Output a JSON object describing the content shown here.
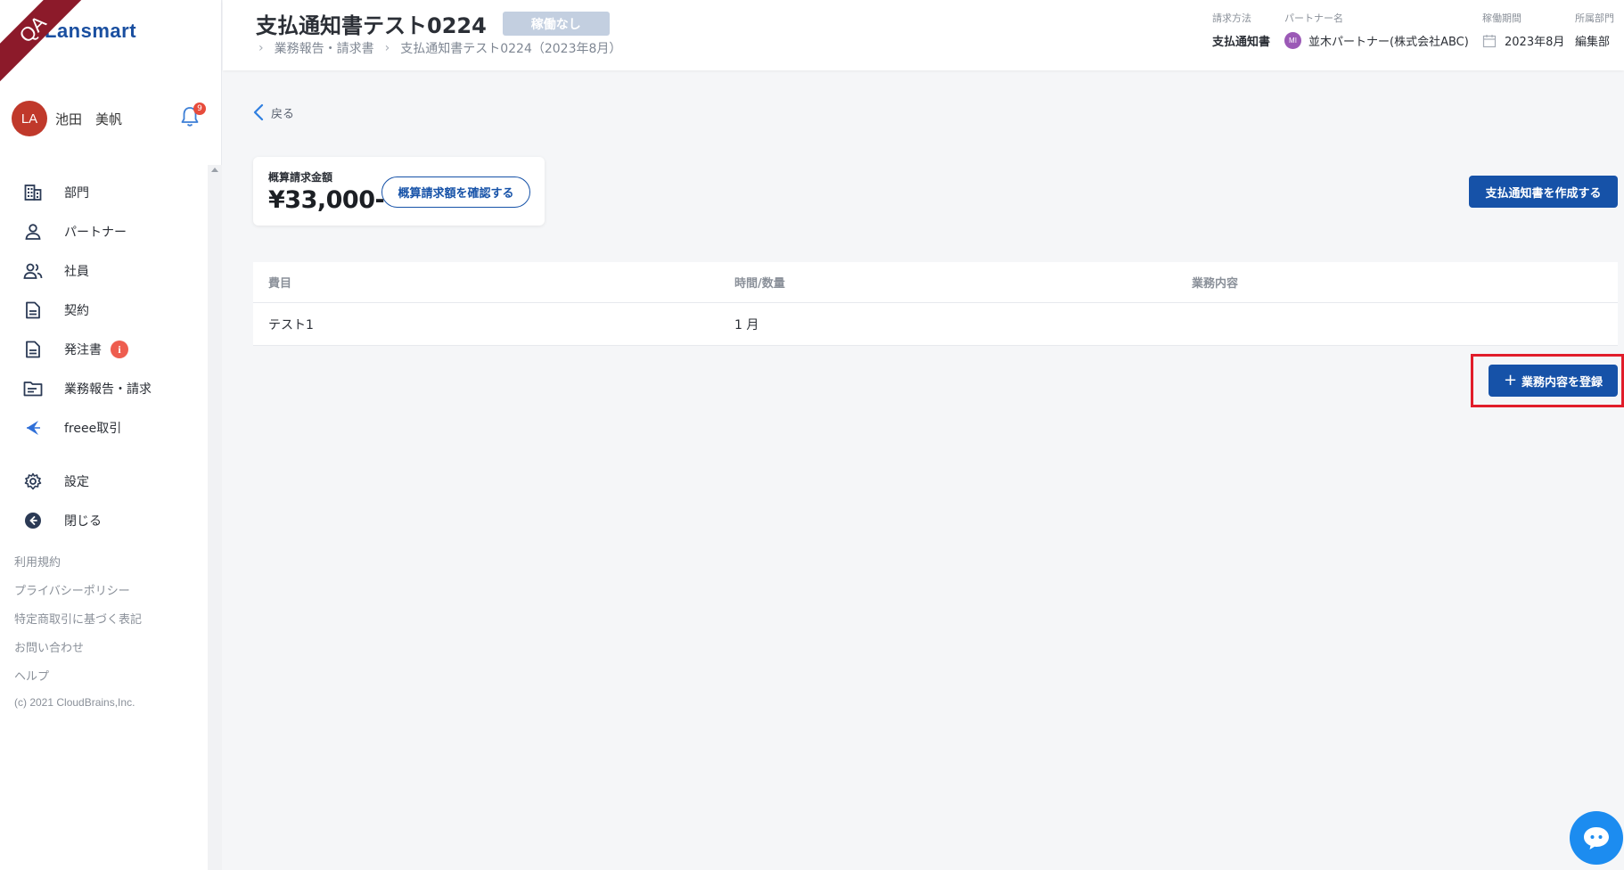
{
  "ribbon": "QA",
  "brand": "Lansmart",
  "user": {
    "initials": "LA",
    "name": "池田　美帆",
    "notification_count": "9"
  },
  "nav": [
    {
      "label": "部門",
      "icon": "building-icon"
    },
    {
      "label": "パートナー",
      "icon": "person-icon"
    },
    {
      "label": "社員",
      "icon": "people-icon"
    },
    {
      "label": "契約",
      "icon": "document-icon"
    },
    {
      "label": "発注書",
      "icon": "document-icon",
      "badge": "i"
    },
    {
      "label": "業務報告・請求",
      "icon": "folder-icon"
    },
    {
      "label": "freee取引",
      "icon": "freee-icon"
    },
    {
      "label": "設定",
      "icon": "gear-icon"
    },
    {
      "label": "閉じる",
      "icon": "back-circle-icon"
    }
  ],
  "footer_links": [
    "利用規約",
    "プライバシーポリシー",
    "特定商取引に基づく表記",
    "お問い合わせ",
    "ヘルプ"
  ],
  "copyright": "(c) 2021 CloudBrains,Inc.",
  "header": {
    "title": "支払通知書テスト0224",
    "status": "稼働なし",
    "breadcrumb": [
      "業務報告・請求書",
      "支払通知書テスト0224（2023年8月）"
    ],
    "meta": {
      "billing_method_label": "請求方法",
      "billing_method": "支払通知書",
      "partner_label": "パートナー名",
      "partner_initials": "MI",
      "partner_name": "並木パートナー(株式会社ABC)",
      "period_label": "稼働期間",
      "period": "2023年8月",
      "department_label": "所属部門",
      "department": "編集部"
    }
  },
  "back_label": "戻る",
  "estimate": {
    "label": "概算請求金額",
    "amount": "¥33,000-",
    "confirm_button": "概算請求額を確認する"
  },
  "create_button": "支払通知書を作成する",
  "table": {
    "headers": [
      "費目",
      "時間/数量",
      "業務内容"
    ],
    "rows": [
      [
        "テスト1",
        "1 月",
        ""
      ]
    ]
  },
  "register_button": "業務内容を登録",
  "colors": {
    "primary": "#1652a8",
    "highlight": "#e11d2a",
    "ribbon": "#8c1a2a",
    "chat": "#1c8cf0"
  }
}
